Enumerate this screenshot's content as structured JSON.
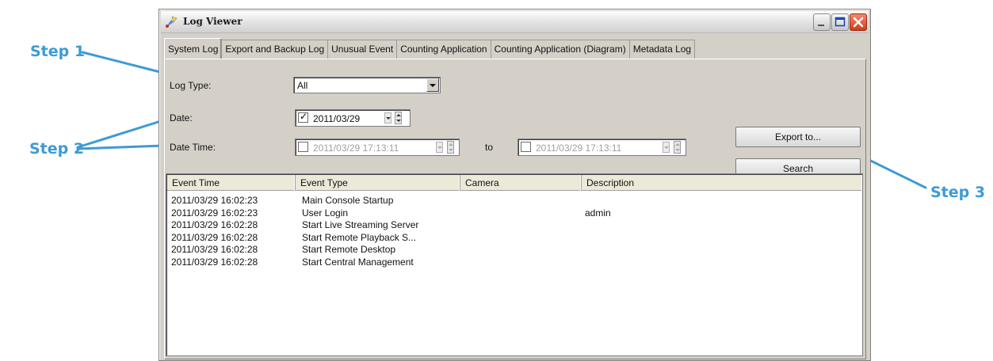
{
  "callouts": {
    "step1": "Step 1",
    "step2": "Step 2",
    "step3": "Step 3",
    "color": "#3d9bd6"
  },
  "window": {
    "title": "Log Viewer",
    "icon": "log-viewer-icon",
    "controls": [
      "minimize-icon",
      "maximize-icon",
      "close-icon"
    ]
  },
  "tabs": [
    {
      "label": "System Log",
      "active": true
    },
    {
      "label": "Export and Backup Log",
      "active": false
    },
    {
      "label": "Unusual Event",
      "active": false
    },
    {
      "label": "Counting Application",
      "active": false
    },
    {
      "label": "Counting Application (Diagram)",
      "active": false
    },
    {
      "label": "Metadata Log",
      "active": false
    }
  ],
  "filters": {
    "log_type_label": "Log Type:",
    "log_type_value": "All",
    "date_label": "Date:",
    "date_checked": true,
    "date_value": "2011/03/29",
    "datetime_label": "Date Time:",
    "datetime_from": "2011/03/29 17:13:11",
    "datetime_to_label": "to",
    "datetime_to": "2011/03/29 17:13:11",
    "datetime_enabled": false
  },
  "buttons": {
    "export": "Export to...",
    "search": "Search"
  },
  "table": {
    "columns": [
      "Event Time",
      "Event Type",
      "Camera",
      "Description"
    ],
    "rows": [
      [
        "2011/03/29 16:02:23",
        "Main Console Startup",
        "",
        ""
      ],
      [
        "2011/03/29 16:02:23",
        "User Login",
        "",
        "admin"
      ],
      [
        "2011/03/29 16:02:28",
        "Start Live Streaming Server",
        "",
        ""
      ],
      [
        "2011/03/29 16:02:28",
        "Start Remote Playback S...",
        "",
        ""
      ],
      [
        "2011/03/29 16:02:28",
        "Start Remote Desktop",
        "",
        ""
      ],
      [
        "2011/03/29 16:02:28",
        "Start Central Management",
        "",
        ""
      ]
    ]
  }
}
